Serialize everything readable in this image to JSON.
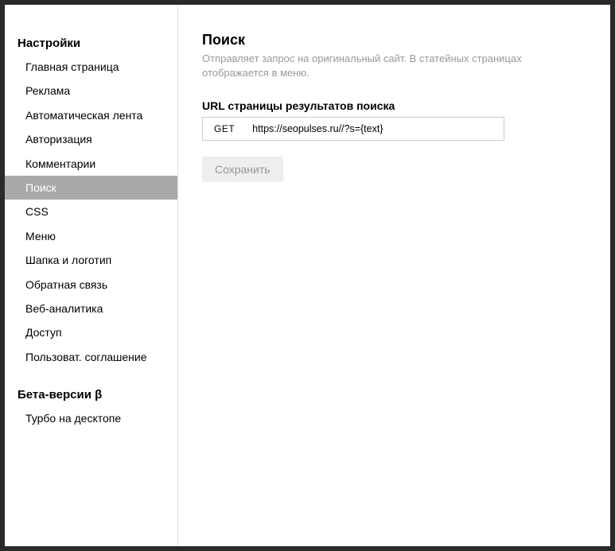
{
  "sidebar": {
    "section1_title": "Настройки",
    "items": [
      {
        "label": "Главная страница"
      },
      {
        "label": "Реклама"
      },
      {
        "label": "Автоматическая лента"
      },
      {
        "label": "Авторизация"
      },
      {
        "label": "Комментарии"
      },
      {
        "label": "Поиск"
      },
      {
        "label": "CSS"
      },
      {
        "label": "Меню"
      },
      {
        "label": "Шапка и логотип"
      },
      {
        "label": "Обратная связь"
      },
      {
        "label": "Веб-аналитика"
      },
      {
        "label": "Доступ"
      },
      {
        "label": "Пользоват. соглашение"
      }
    ],
    "section2_title": "Бета-версии β",
    "items2": [
      {
        "label": "Турбо на десктопе"
      }
    ]
  },
  "main": {
    "title": "Поиск",
    "description": "Отправляет запрос на оригинальный сайт. В статейных страницах отображается в меню.",
    "field_label": "URL страницы результатов поиска",
    "method": "GET",
    "url_value": "https://seopulses.ru//?s={text}",
    "save_label": "Сохранить"
  }
}
